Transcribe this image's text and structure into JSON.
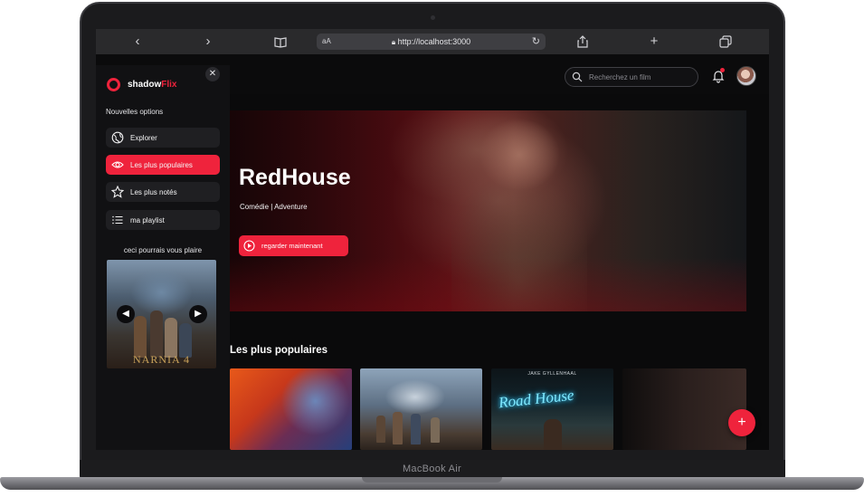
{
  "device": {
    "label": "MacBook Air"
  },
  "browser": {
    "url": "http://localhost:3000",
    "text_size_label": "aA"
  },
  "app": {
    "logo_main": "shadow",
    "logo_accent": "Flix",
    "brand_color": "#ef233c",
    "search": {
      "placeholder": "Recherchez un film"
    }
  },
  "sidebar": {
    "section_label": "Nouvelles options",
    "items": [
      {
        "label": "Explorer",
        "icon": "globe-icon",
        "active": false
      },
      {
        "label": "Les plus populaires",
        "icon": "eye-icon",
        "active": true
      },
      {
        "label": "Les plus notés",
        "icon": "star-icon",
        "active": false
      },
      {
        "label": "ma playlist",
        "icon": "list-icon",
        "active": false
      }
    ],
    "suggest_label": "ceci pourrais vous plaire",
    "suggest_poster_title": "NARNIA 4"
  },
  "hero": {
    "title": "RedHouse",
    "genres": "Comédie | Adventure",
    "cta_label": "regarder maintenant"
  },
  "popular": {
    "title": "Les plus populaires",
    "card3_top_text": "JAKE GYLLENHAAL",
    "card3_neon_text": "Road House"
  }
}
